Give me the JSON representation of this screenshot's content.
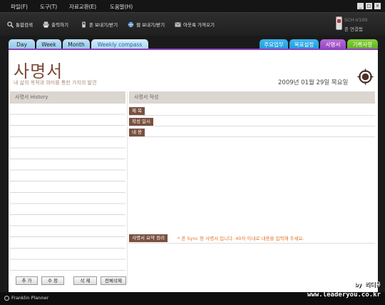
{
  "menubar": {
    "items": [
      "파일(F)",
      "도구(T)",
      "자료교환(E)",
      "도움말(H)"
    ],
    "window_buttons": [
      "_",
      "□",
      "×"
    ]
  },
  "toolbar": {
    "items": [
      {
        "label": "통합검색",
        "icon": "search-icon"
      },
      {
        "label": "출력하기",
        "icon": "printer-icon"
      },
      {
        "label": "폰 보내기/받기",
        "icon": "phone-icon"
      },
      {
        "label": "웹 보내기/받기",
        "icon": "web-icon"
      },
      {
        "label": "아웃룩 가져오기",
        "icon": "outlook-icon"
      }
    ],
    "device": {
      "model": "SCH-V100",
      "status": "폰 연결됨"
    }
  },
  "tabs": {
    "left": [
      "Day",
      "Week",
      "Month",
      "Weekly compass"
    ],
    "right": [
      {
        "label": "주요업무",
        "color": "#1f96d8"
      },
      {
        "label": "목표설정",
        "color": "#1f96d8"
      },
      {
        "label": "사명서",
        "color": "#8f42bd"
      },
      {
        "label": "기록사항",
        "color": "#5aa922"
      }
    ]
  },
  "page": {
    "title": "사명서",
    "subtitle": "내 삶의 목적과 의미를 통한 가치의 발견",
    "date": "2009년 01월 29일 목요일"
  },
  "left_panel": {
    "header": "사명서 History",
    "buttons": [
      "추 가",
      "수 정",
      "삭 제",
      "전체삭제"
    ]
  },
  "right_panel": {
    "header": "사명서 작성",
    "fields": [
      "제 목",
      "작성 일시",
      "내 용"
    ],
    "summary_label": "사명서 요약 정리",
    "summary_hint": "* 폰 Sync 용 사명서 입니다. 40자 이내로 내용을 입력해 주세요."
  },
  "status": {
    "brand": "Franklin Planner"
  },
  "watermark": {
    "line1": "by 리더유",
    "line2": "www.leaderyou.co.kr"
  },
  "colors": {
    "accent_purple": "#8f42bd",
    "label_brown": "#7a5040",
    "hint_orange": "#e2742a"
  }
}
